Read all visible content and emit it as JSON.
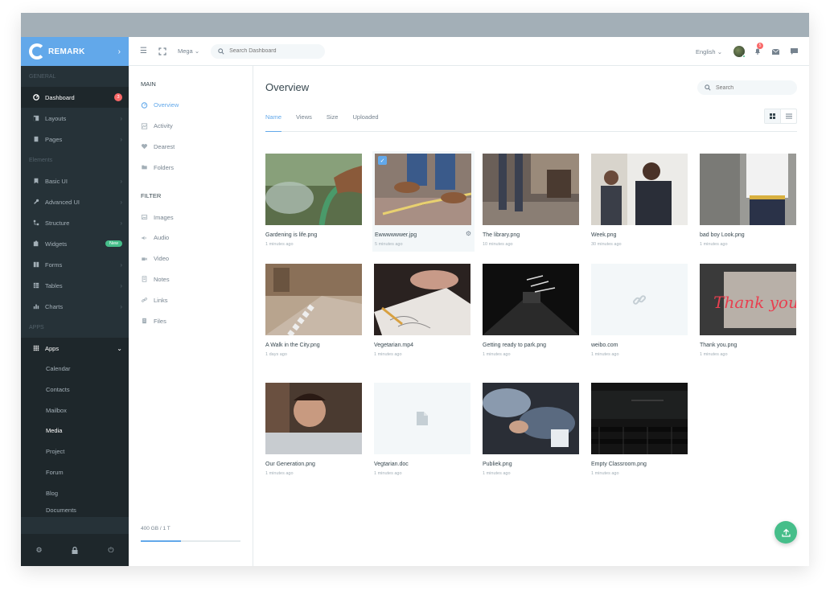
{
  "brand": {
    "name": "REMARK"
  },
  "sidebar": {
    "cat_general": "GENERAL",
    "cat_elements": "Elements",
    "cat_apps": "APPS",
    "general": [
      {
        "label": "Dashboard",
        "badge": "3"
      },
      {
        "label": "Layouts"
      },
      {
        "label": "Pages"
      }
    ],
    "elements": [
      {
        "label": "Basic UI"
      },
      {
        "label": "Advanced UI"
      },
      {
        "label": "Structure"
      },
      {
        "label": "Widgets",
        "badge": "New"
      },
      {
        "label": "Forms"
      },
      {
        "label": "Tables"
      },
      {
        "label": "Charts"
      }
    ],
    "apps": {
      "label": "Apps"
    },
    "app_items": [
      "Calendar",
      "Contacts",
      "Mailbox",
      "Media",
      "Project",
      "Forum",
      "Blog",
      "Documents"
    ]
  },
  "topbar": {
    "mega": "Mega",
    "search_placeholder": "Search Dashboard",
    "language": "English",
    "notification_count": "5"
  },
  "panel": {
    "main_head": "MAIN",
    "main_items": [
      "Overview",
      "Activity",
      "Dearest",
      "Folders"
    ],
    "filter_head": "FILTER",
    "filter_items": [
      "Images",
      "Audio",
      "Video",
      "Notes",
      "Links",
      "Files"
    ],
    "storage": "400 GB / 1 T",
    "storage_fraction": 0.4
  },
  "main": {
    "title": "Overview",
    "search_placeholder": "Search",
    "tabs": [
      "Name",
      "Views",
      "Size",
      "Uploaded"
    ]
  },
  "files": [
    {
      "name": "Gardening is life.png",
      "time": "1 minutes ago"
    },
    {
      "name": "Ewwwwwwer.jpg",
      "time": "5 minutes ago"
    },
    {
      "name": "The library.png",
      "time": "10 minutes ago"
    },
    {
      "name": "Week.png",
      "time": "30 minutes ago"
    },
    {
      "name": "bad boy Look.png",
      "time": "1 minutes ago"
    },
    {
      "name": "A Walk in the City.png",
      "time": "1 days ago"
    },
    {
      "name": "Vegetarian.mp4",
      "time": "1 minutes ago"
    },
    {
      "name": "Getting ready to park.png",
      "time": "1 minutes ago"
    },
    {
      "name": "weibo.com",
      "time": "1 minutes ago"
    },
    {
      "name": "Thank you.png",
      "time": "1 minutes ago"
    },
    {
      "name": "Our Generation.png",
      "time": "1 minutes ago"
    },
    {
      "name": "Vegtarian.doc",
      "time": "1 minutes ago"
    },
    {
      "name": "Publiek.png",
      "time": "1 minutes ago"
    },
    {
      "name": "Empty Classroom.png",
      "time": "1 minutes ago"
    }
  ],
  "neon_text": "Thank you",
  "colors": {
    "brand": "#62a8ea",
    "sidebar": "#263238",
    "accent_green": "#46be8a",
    "badge_red": "#f96868"
  }
}
